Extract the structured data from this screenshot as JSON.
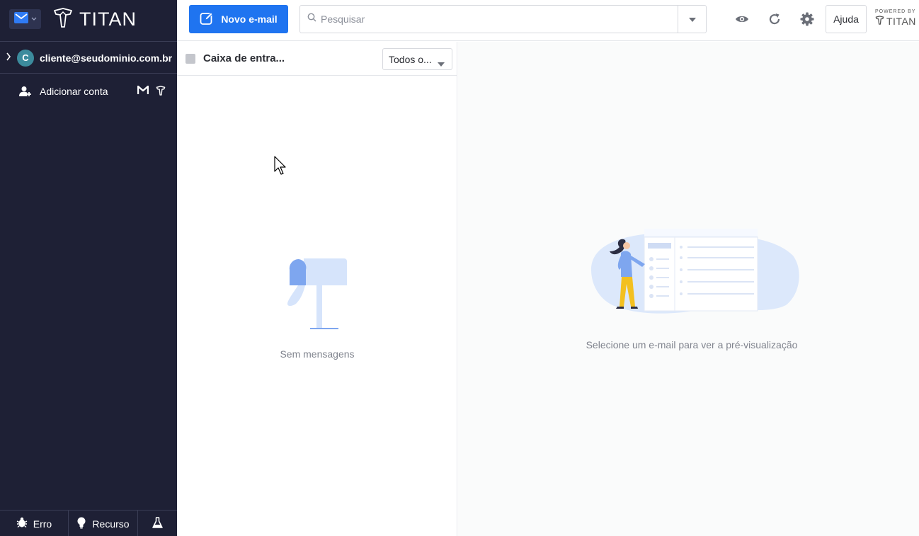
{
  "brand": {
    "name": "TITAN"
  },
  "account": {
    "initial": "C",
    "email": "cliente@seudominio.com.br"
  },
  "sidebar": {
    "add_account_label": "Adicionar conta"
  },
  "footer": {
    "bug_label": "Erro",
    "feature_label": "Recurso"
  },
  "toolbar": {
    "compose_label": "Novo e-mail",
    "search_placeholder": "Pesquisar",
    "help_label": "Ajuda",
    "powered_by_label": "POWERED BY",
    "powered_by_brand": "TITAN"
  },
  "list": {
    "folder_name": "Caixa de entra...",
    "filter_label": "Todos o...",
    "empty_text": "Sem mensagens"
  },
  "preview": {
    "empty_text": "Selecione um e-mail para ver a pré-visualização"
  },
  "colors": {
    "sidebar_bg": "#1e2035",
    "accent": "#1f74f0"
  }
}
